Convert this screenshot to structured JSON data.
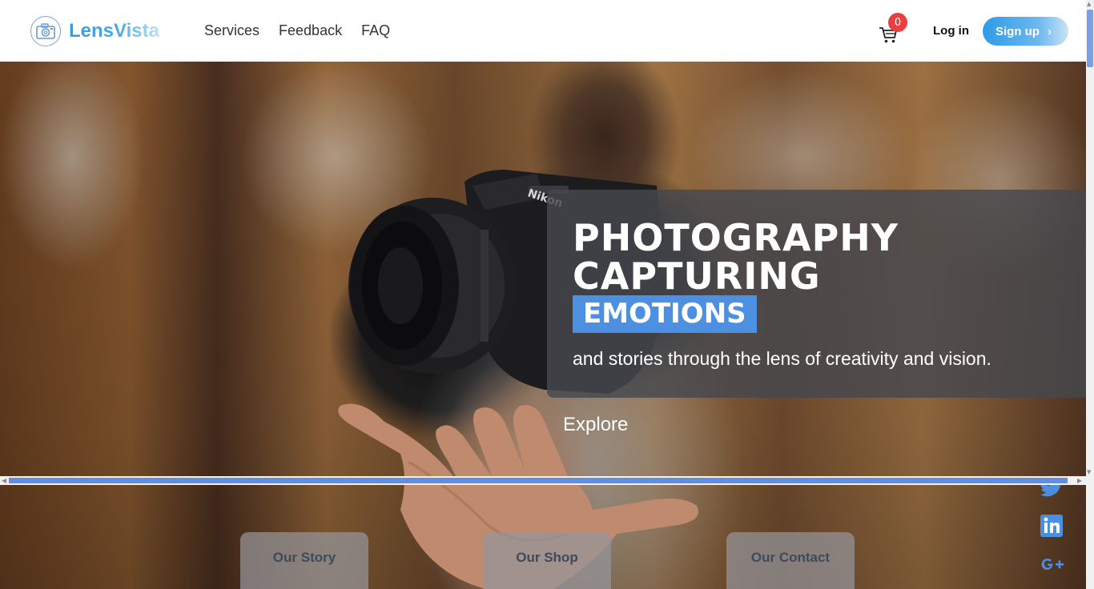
{
  "header": {
    "brand": "LensVista",
    "nav": [
      "Services",
      "Feedback",
      "FAQ"
    ],
    "cart_count": "0",
    "login_label": "Log in",
    "signup_label": "Sign up"
  },
  "hero": {
    "title_line1": "PHOTOGRAPHY",
    "title_line2": "CAPTURING",
    "highlight": "EMOTIONS",
    "subtitle": "and stories through the lens of creativity and vision.",
    "cta": "Explore"
  },
  "cards": [
    "Our Story",
    "Our Shop",
    "Our Contact"
  ],
  "social": [
    "twitter-icon",
    "linkedin-icon",
    "google-plus-icon"
  ],
  "colors": {
    "accent": "#4d8fe0",
    "signup_start": "#2f9be6",
    "badge": "#e84040",
    "social": "#4a8fe0"
  }
}
